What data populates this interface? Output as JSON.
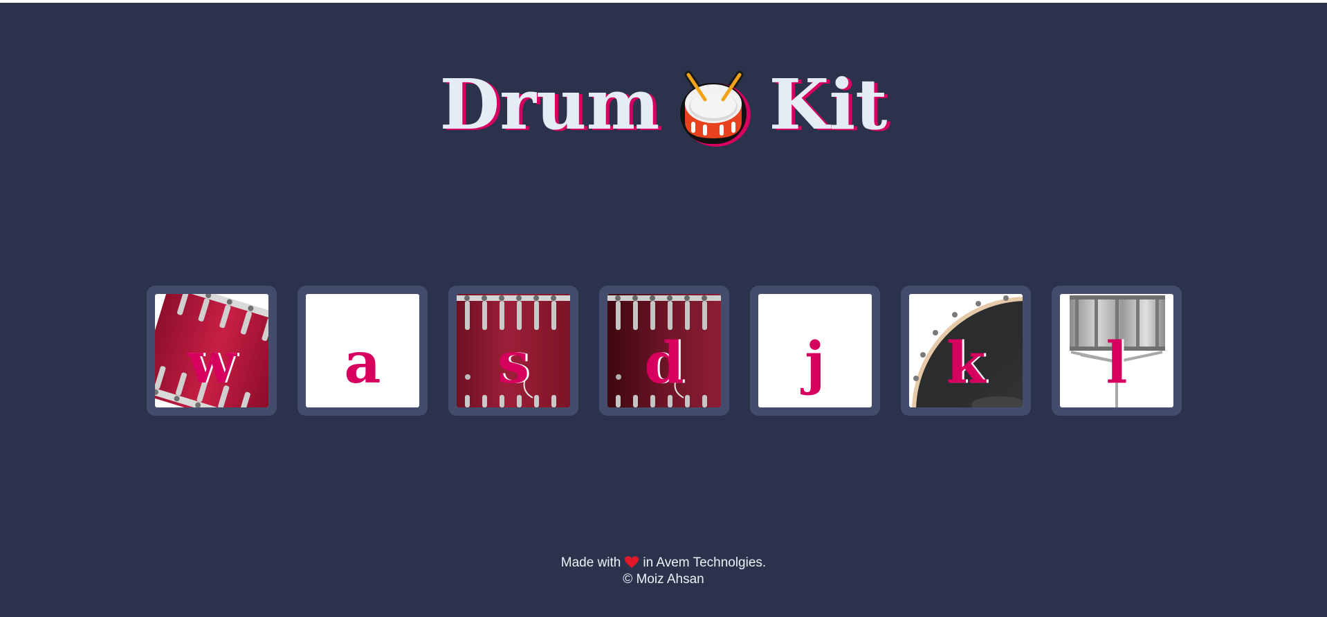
{
  "header": {
    "title_left": "Drum",
    "title_right": "Kit",
    "title_icon": "drum-emoji-icon"
  },
  "keys": [
    {
      "letter": "w",
      "image": "tom-tilted"
    },
    {
      "letter": "a",
      "image": "blank"
    },
    {
      "letter": "s",
      "image": "tom-red"
    },
    {
      "letter": "d",
      "image": "tom-dark-red"
    },
    {
      "letter": "j",
      "image": "blank"
    },
    {
      "letter": "k",
      "image": "kick-drum"
    },
    {
      "letter": "l",
      "image": "snare-stand"
    }
  ],
  "footer": {
    "made_with": "Made with",
    "heart_icon": "heart-icon",
    "company": "in Avem Technolgies.",
    "copyright": "© Moiz Ahsan"
  },
  "colors": {
    "background": "#2b324c",
    "key_frame": "#434c6b",
    "accent": "#d6005f",
    "title_text": "#e6ecf5"
  }
}
